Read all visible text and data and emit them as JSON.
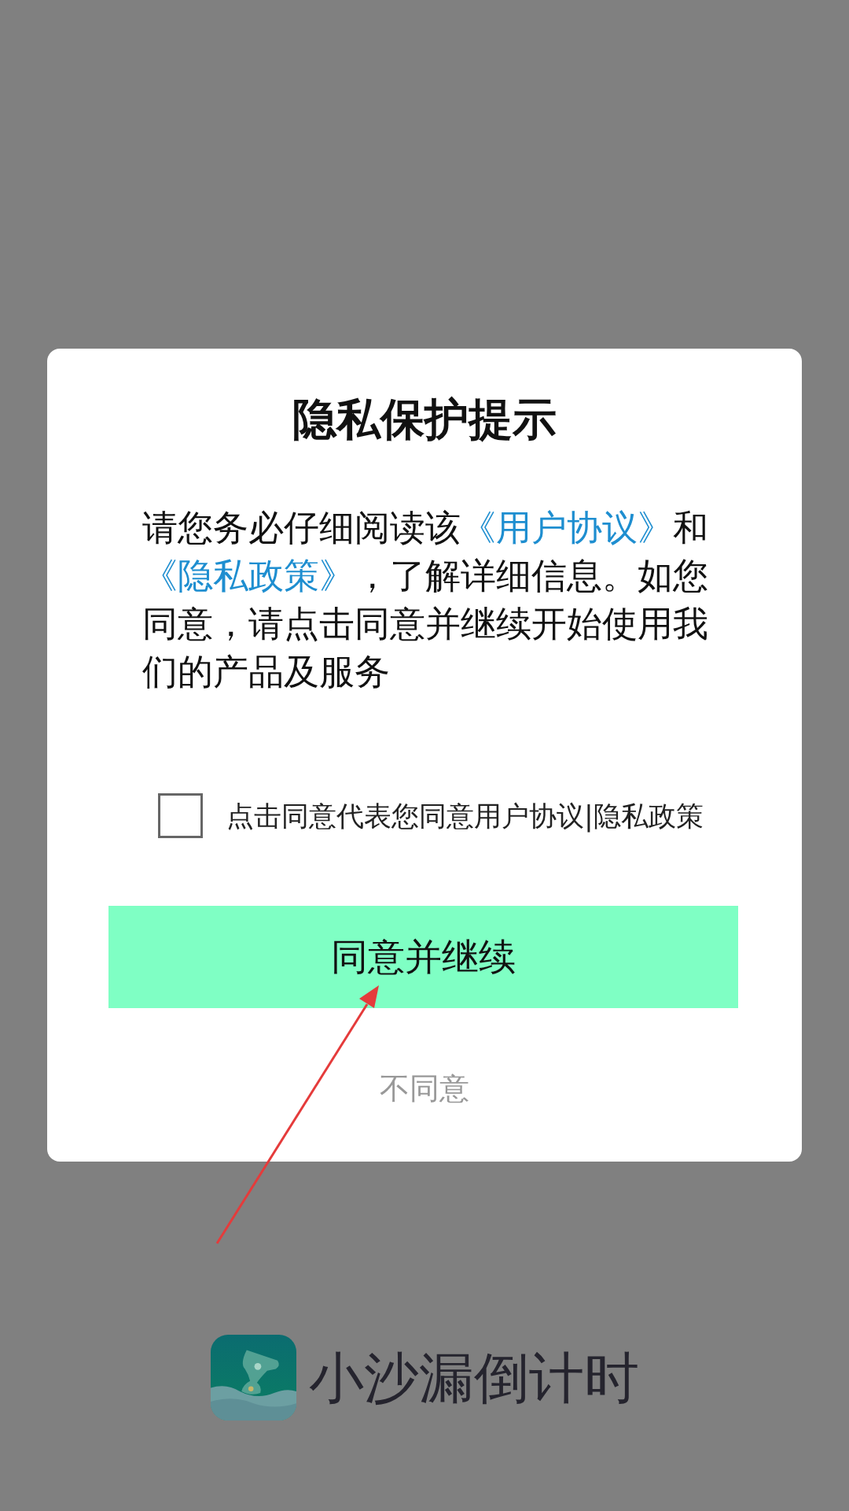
{
  "dialog": {
    "title": "隐私保护提示",
    "message": [
      {
        "kind": "text",
        "text": "请您务必仔细阅读该"
      },
      {
        "kind": "link",
        "text": "《用户协议》"
      },
      {
        "kind": "text",
        "text": "和"
      },
      {
        "kind": "link",
        "text": "《隐私政策》"
      },
      {
        "kind": "text",
        "text": "，了解详细信息。如您同意，请点击同意并继续开始使用我们的产品及服务"
      }
    ],
    "consent": {
      "label": "点击同意代表您同意用户协议|隐私政策",
      "checked": false
    },
    "buttons": [
      {
        "kind": "primary",
        "label": "同意并继续"
      },
      {
        "kind": "plain",
        "label": "不同意"
      }
    ]
  },
  "splash": {
    "app_name": "小沙漏倒计时"
  }
}
